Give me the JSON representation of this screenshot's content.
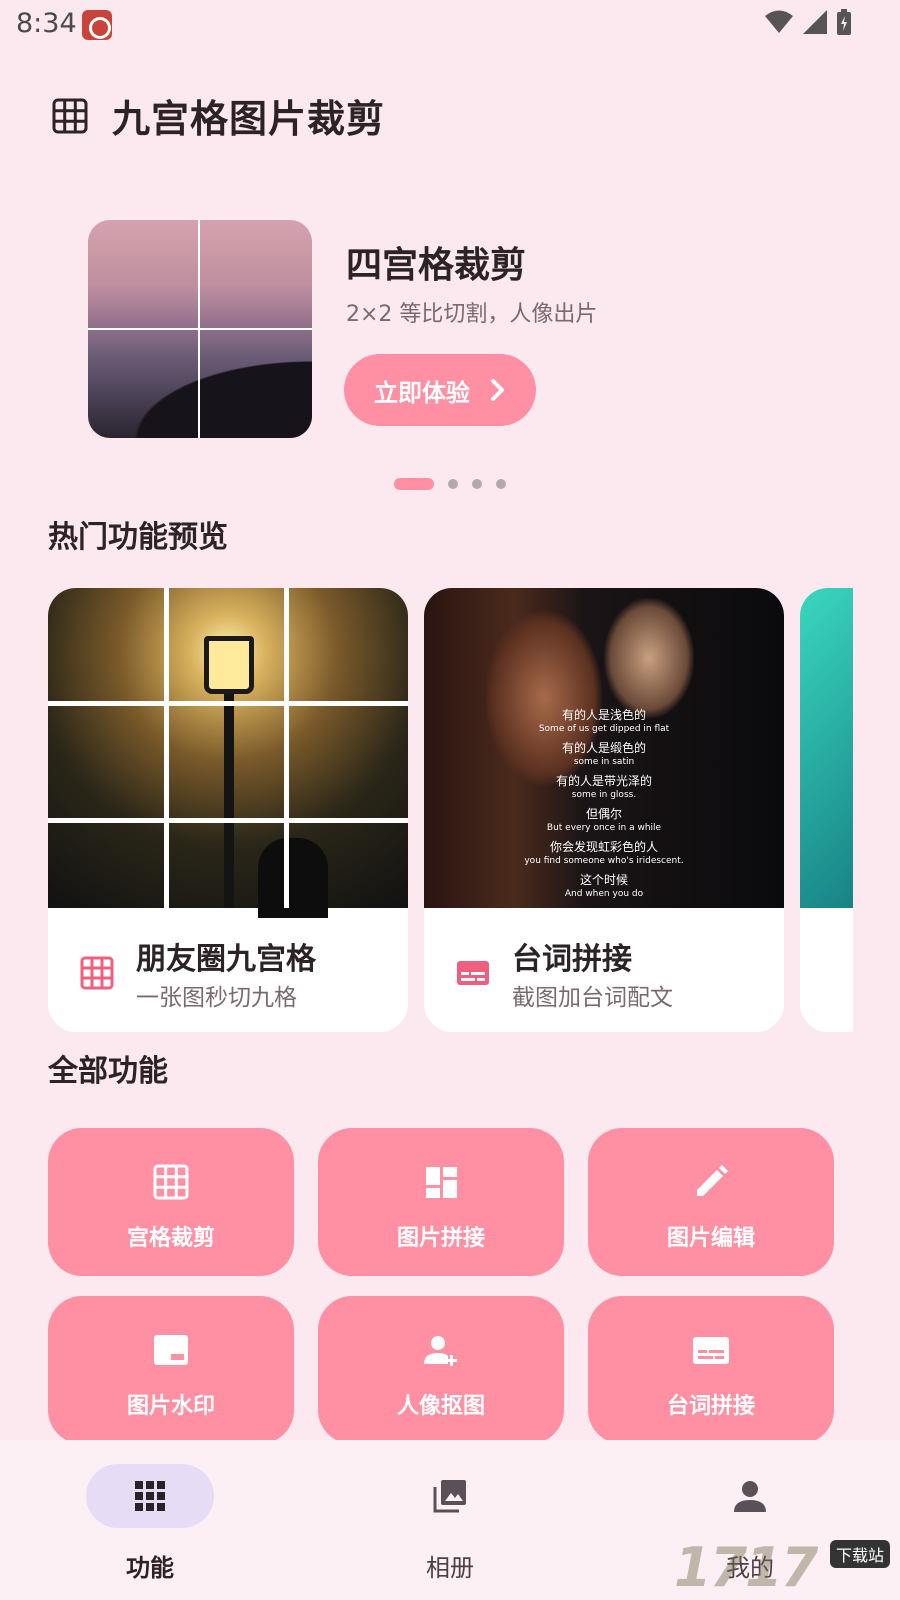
{
  "status_bar": {
    "time": "8:34"
  },
  "app_bar": {
    "title": "九宫格图片裁剪"
  },
  "banner": {
    "title": "四宫格裁剪",
    "subtitle": "2×2 等比切割，人像出片",
    "cta_label": "立即体验",
    "page_count": 4,
    "active_page": 1
  },
  "hot_section": {
    "title": "热门功能预览",
    "cards": [
      {
        "title": "朋友圈九宫格",
        "subtitle": "一张图秒切九格",
        "icon": "grid-icon"
      },
      {
        "title": "台词拼接",
        "subtitle": "截图加台词配文",
        "icon": "subtitles-icon",
        "subtitles": [
          {
            "cn": "有的人是浅色的",
            "en": "Some of us get dipped in flat"
          },
          {
            "cn": "有的人是缎色的",
            "en": "some in satin"
          },
          {
            "cn": "有的人是带光泽的",
            "en": "some in gloss."
          },
          {
            "cn": "但偶尔",
            "en": "But every once in a while"
          },
          {
            "cn": "你会发现虹彩色的人",
            "en": "you find someone who's iridescent."
          },
          {
            "cn": "这个时候",
            "en": "And when you do"
          }
        ]
      }
    ]
  },
  "all_section": {
    "title": "全部功能",
    "items": [
      {
        "label": "宫格裁剪",
        "icon": "grid-icon"
      },
      {
        "label": "图片拼接",
        "icon": "dashboard-icon"
      },
      {
        "label": "图片编辑",
        "icon": "pencil-icon"
      },
      {
        "label": "图片水印",
        "icon": "watermark-icon"
      },
      {
        "label": "人像抠图",
        "icon": "person-add-icon"
      },
      {
        "label": "台词拼接",
        "icon": "subtitles-icon"
      }
    ]
  },
  "bottom_nav": {
    "items": [
      {
        "label": "功能",
        "icon": "apps-icon",
        "active": true
      },
      {
        "label": "相册",
        "icon": "photo-library-icon",
        "active": false
      },
      {
        "label": "我的",
        "icon": "person-icon",
        "active": false
      }
    ]
  },
  "watermark": {
    "text": "1717",
    "badge": "下载站"
  },
  "colors": {
    "background": "#fce8ef",
    "accent": "#ff8fa3",
    "nav_active_pill": "#e6dcf5",
    "text": "#2b2326"
  }
}
